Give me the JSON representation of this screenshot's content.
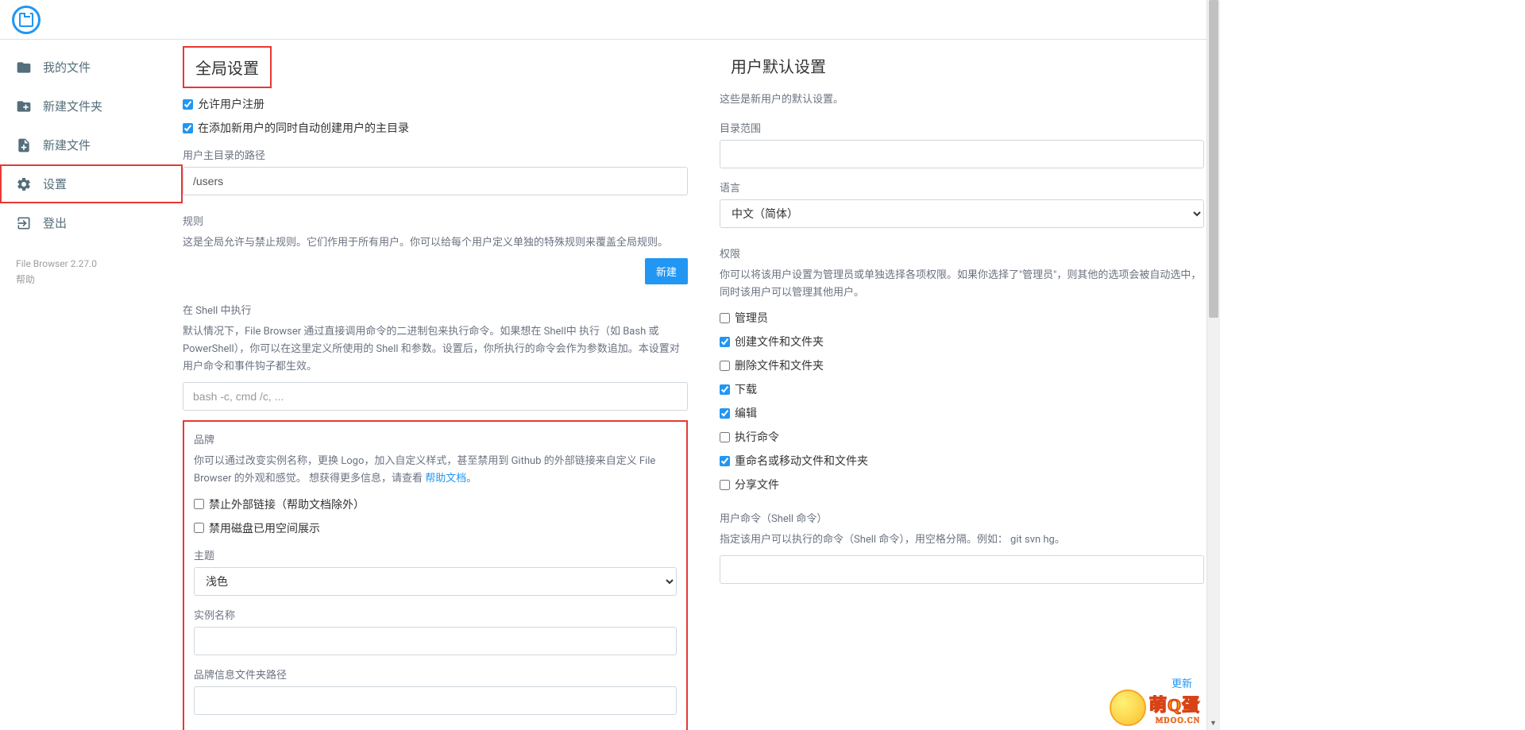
{
  "sidebar": {
    "items": [
      {
        "label": "我的文件"
      },
      {
        "label": "新建文件夹"
      },
      {
        "label": "新建文件"
      },
      {
        "label": "设置"
      },
      {
        "label": "登出"
      }
    ],
    "version": "File Browser 2.27.0",
    "help": "帮助"
  },
  "global": {
    "title": "全局设置",
    "allow_signup": "允许用户注册",
    "auto_create_home": "在添加新用户的同时自动创建用户的主目录",
    "home_path_label": "用户主目录的路径",
    "home_path_value": "/users",
    "rules_label": "规则",
    "rules_desc": "这是全局允许与禁止规则。它们作用于所有用户。你可以给每个用户定义单独的特殊规则来覆盖全局规则。",
    "new_btn": "新建",
    "shell_label": "在 Shell 中执行",
    "shell_desc": "默认情况下，File Browser 通过直接调用命令的二进制包来执行命令。如果想在 Shell中 执行（如 Bash 或 PowerShell），你可以在这里定义所使用的 Shell 和参数。设置后，你所执行的命令会作为参数追加。本设置对用户命令和事件钩子都生效。",
    "shell_placeholder": "bash -c, cmd /c, ...",
    "brand": {
      "title": "品牌",
      "desc_a": "你可以通过改变实例名称，更换 Logo，加入自定义样式，甚至禁用到 Github 的外部链接来自定义 File Browser 的外观和感觉。 想获得更多信息，请查看 ",
      "desc_link": "帮助文档",
      "desc_b": "。",
      "disable_external": "禁止外部链接（帮助文档除外）",
      "disable_disk_usage": "禁用磁盘已用空间展示",
      "theme_label": "主题",
      "theme_value": "浅色",
      "instance_name_label": "实例名称",
      "branding_path_label": "品牌信息文件夹路径"
    }
  },
  "user_defaults": {
    "title": "用户默认设置",
    "desc": "这些是新用户的默认设置。",
    "scope_label": "目录范围",
    "language_label": "语言",
    "language_value": "中文（简体）",
    "perms_label": "权限",
    "perms_desc": "你可以将该用户设置为管理员或单独选择各项权限。如果你选择了\"管理员\"，则其他的选项会被自动选中，同时该用户可以管理其他用户。",
    "perms": {
      "admin": "管理员",
      "create": "创建文件和文件夹",
      "delete": "删除文件和文件夹",
      "download": "下载",
      "edit": "编辑",
      "execute": "执行命令",
      "rename": "重命名或移动文件和文件夹",
      "share": "分享文件"
    },
    "commands_label": "用户命令（Shell 命令）",
    "commands_desc": "指定该用户可以执行的命令（Shell 命令），用空格分隔。例如： git svn hg。"
  },
  "watermark": {
    "refresh": "更新",
    "text": "萌Q蛋",
    "sub": "MDOO.CN"
  }
}
